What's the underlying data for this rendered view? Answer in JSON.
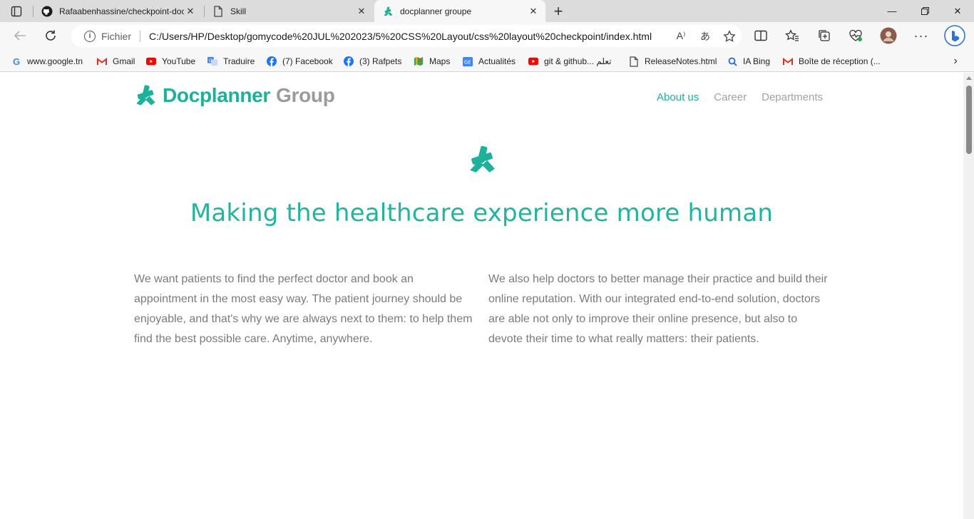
{
  "browser": {
    "tabs": [
      {
        "title": "Rafaabenhassine/checkpoint-doc",
        "icon": "github-icon",
        "active": false
      },
      {
        "title": "Skill",
        "icon": "document-icon",
        "active": false
      },
      {
        "title": "docplanner groupe",
        "icon": "docplanner-icon",
        "active": true
      }
    ],
    "address": {
      "scheme_label": "Fichier",
      "url": "C:/Users/HP/Desktop/gomycode%20JUL%202023/5%20CSS%20Layout/css%20layout%20checkpoint/index.html"
    },
    "bookmarks": [
      {
        "label": "www.google.tn",
        "icon": "google-icon",
        "color": "#4285f4"
      },
      {
        "label": "Gmail",
        "icon": "gmail-icon",
        "color": "#d93025"
      },
      {
        "label": "YouTube",
        "icon": "youtube-icon",
        "color": "#ff0000"
      },
      {
        "label": "Traduire",
        "icon": "translate-icon",
        "color": "#4285f4"
      },
      {
        "label": "(7) Facebook",
        "icon": "facebook-icon",
        "color": "#1877f2"
      },
      {
        "label": "(3) Rafpets",
        "icon": "facebook-icon",
        "color": "#1877f2"
      },
      {
        "label": "Maps",
        "icon": "maps-icon",
        "color": "#34a853"
      },
      {
        "label": "Actualités",
        "icon": "news-icon",
        "color": "#4285f4"
      },
      {
        "label": "git & github... تعلم",
        "icon": "youtube-icon",
        "color": "#ff0000"
      },
      {
        "label": "ReleaseNotes.html",
        "icon": "document-icon",
        "color": "#555555"
      },
      {
        "label": "IA Bing",
        "icon": "search-icon",
        "color": "#2266dd"
      },
      {
        "label": "Boîte de réception (...",
        "icon": "gmail-icon",
        "color": "#d93025"
      }
    ]
  },
  "site": {
    "logo": {
      "brand": "Docplanner",
      "suffix": "Group"
    },
    "nav": [
      {
        "label": "About us",
        "active": true
      },
      {
        "label": "Career",
        "active": false
      },
      {
        "label": "Departments",
        "active": false
      }
    ],
    "headline": "Making the healthcare experience more human",
    "paragraphs": [
      "We want patients to find the perfect doctor and book an appointment in the most easy way. The patient journey should be enjoyable, and that's why we are always next to them: to help them find the best possible care. Anytime, anywhere.",
      "We also help doctors to better manage their practice and build their online reputation. With our integrated end-to-end solution, doctors are able not only to improve their online presence, but also to devote their time to what really matters: their patients."
    ],
    "colors": {
      "accent": "#1cb19a",
      "muted": "#9b9b9b",
      "body_text": "#7b7b7b"
    }
  }
}
